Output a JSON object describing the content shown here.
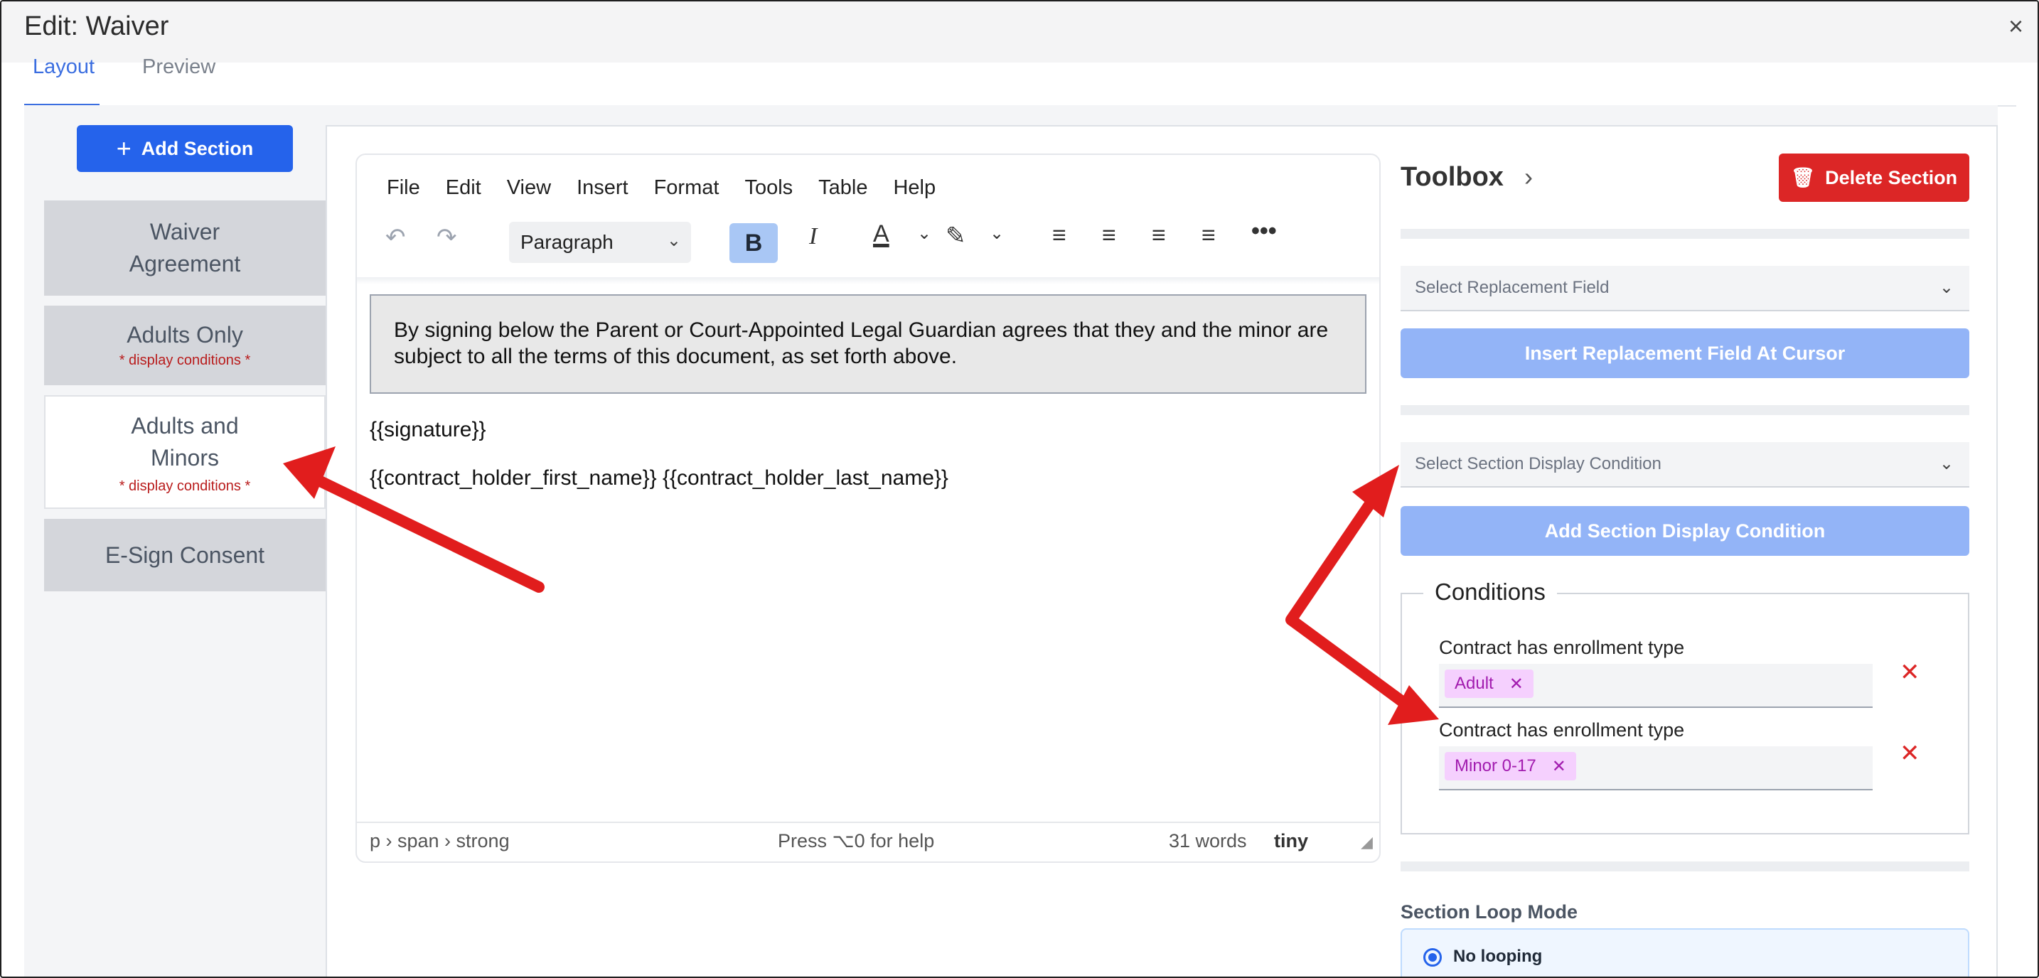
{
  "window": {
    "title": "Edit: Waiver",
    "close": "×"
  },
  "tabs": [
    {
      "label": "Layout",
      "active": true
    },
    {
      "label": "Preview",
      "active": false
    }
  ],
  "sections_panel": {
    "add_button": "Add Section",
    "items": [
      {
        "label": "Waiver Agreement",
        "cond": "",
        "selected": false
      },
      {
        "label": "Adults Only",
        "cond": "* display conditions *",
        "selected": false
      },
      {
        "label": "Adults and Minors",
        "cond": "* display conditions *",
        "selected": true
      },
      {
        "label": "E-Sign Consent",
        "cond": "",
        "selected": false
      }
    ]
  },
  "editor": {
    "menu": [
      "File",
      "Edit",
      "View",
      "Insert",
      "Format",
      "Tools",
      "Table",
      "Help"
    ],
    "block_format": "Paragraph",
    "bold_active": true,
    "highlighted_paragraph": "By signing below the Parent or Court-Appointed Legal Guardian agrees that they and the minor are subject to all the terms of this document, as set forth above.",
    "lines": [
      "{{signature}}",
      "{{contract_holder_first_name}} {{contract_holder_last_name}}"
    ],
    "status": {
      "path": "p › span › strong",
      "help": "Press ⌥0 for help",
      "words": "31 words",
      "brand": "tiny"
    }
  },
  "toolbox": {
    "title": "Toolbox",
    "delete_button": "Delete Section",
    "replacement_select_placeholder": "Select Replacement Field",
    "insert_button": "Insert Replacement Field At Cursor",
    "condition_select_placeholder": "Select Section Display Condition",
    "add_condition_button": "Add Section Display Condition",
    "conditions": {
      "legend": "Conditions",
      "items": [
        {
          "label": "Contract has enrollment type",
          "value": "Adult"
        },
        {
          "label": "Contract has enrollment type",
          "value": "Minor 0-17"
        }
      ]
    },
    "loop": {
      "label": "Section Loop Mode",
      "selected_option": "No looping"
    }
  },
  "annotation_color": "#e11d1d"
}
